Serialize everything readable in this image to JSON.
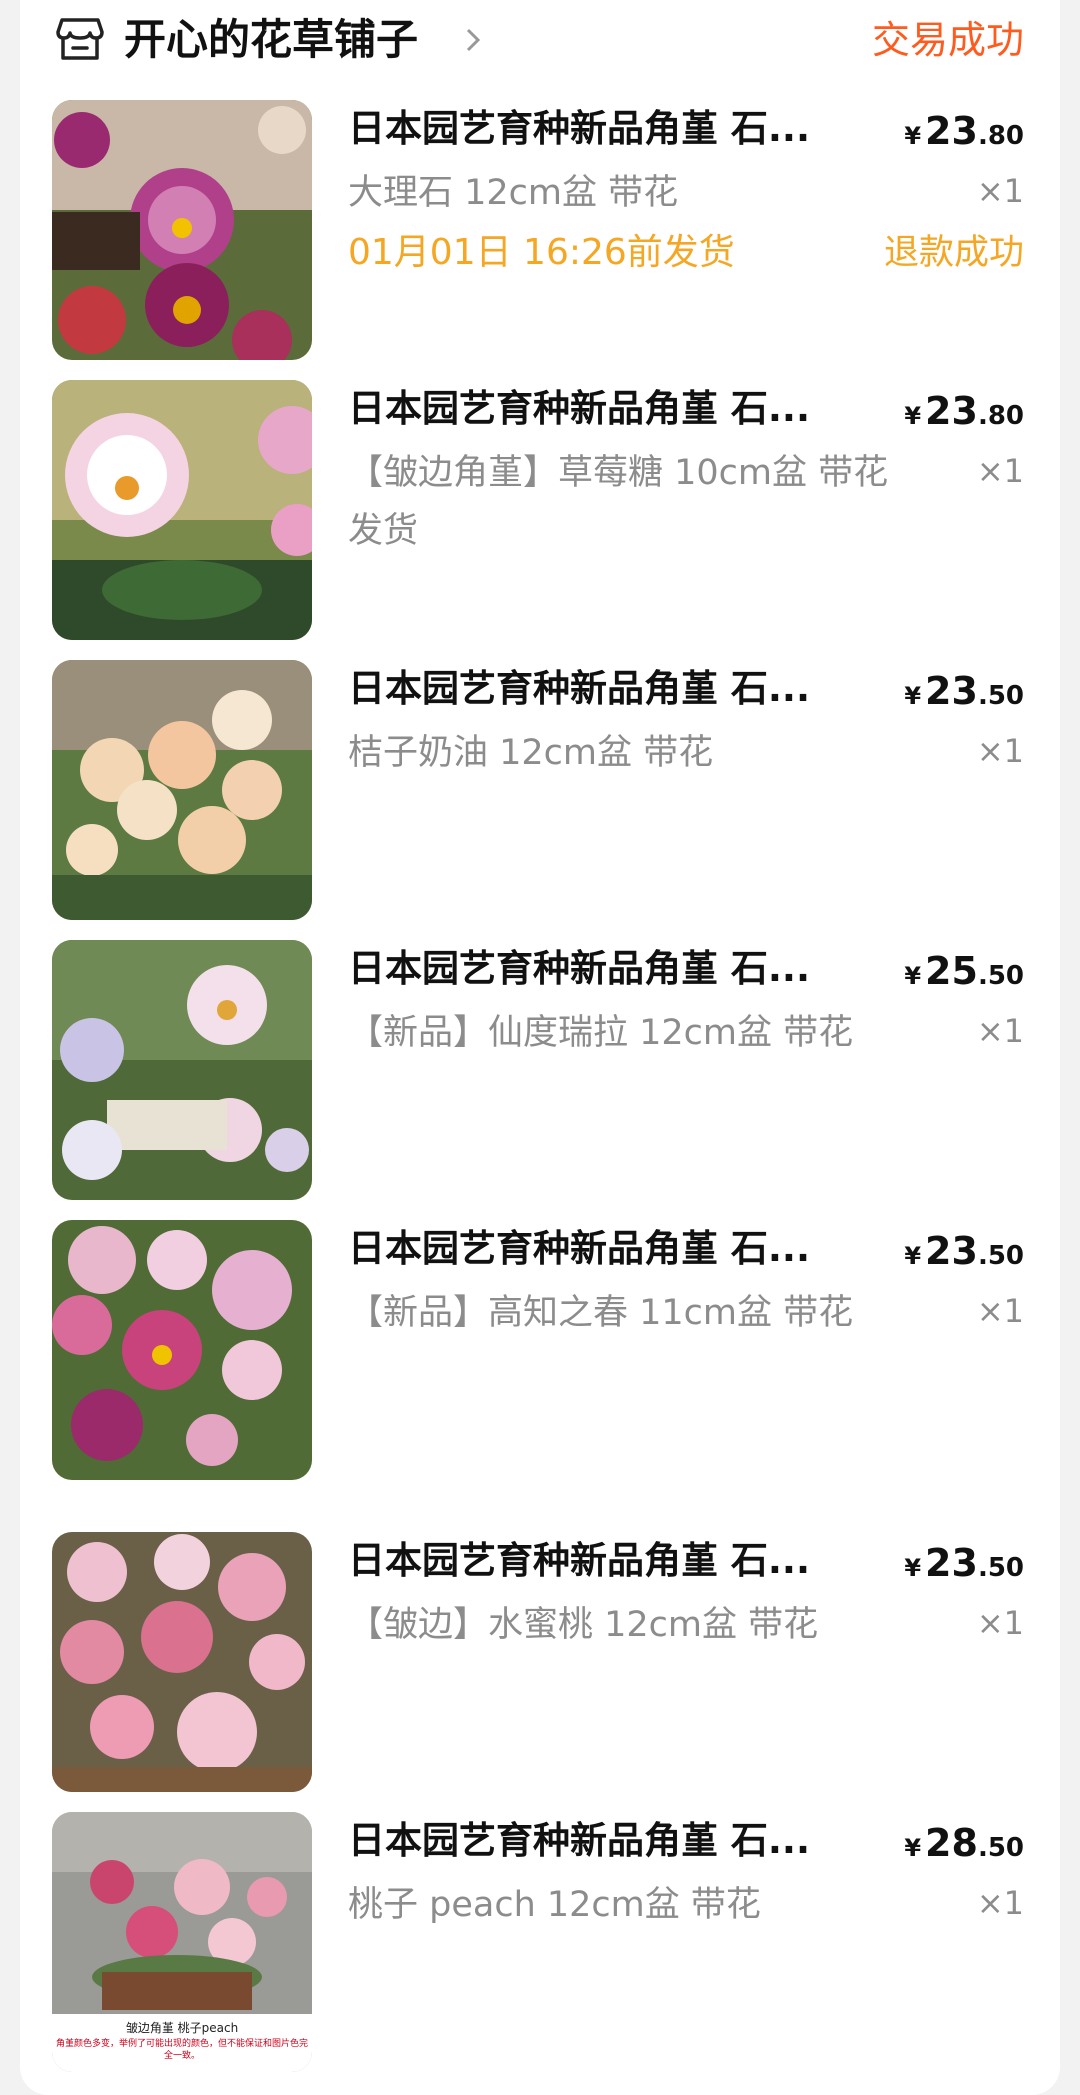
{
  "shop": {
    "name": "开心的花草铺子",
    "order_status": "交易成功"
  },
  "items": [
    {
      "title": "日本园艺育种新品角堇 石...",
      "price_currency": "¥",
      "price_int": "23",
      "price_dec": ".80",
      "sku": "大理石 12cm盆 带花",
      "qty": "×1",
      "ship_note": "01月01日 16:26前发货",
      "refund_status": "退款成功"
    },
    {
      "title": "日本园艺育种新品角堇 石...",
      "price_currency": "¥",
      "price_int": "23",
      "price_dec": ".80",
      "sku": "【皱边角堇】草莓糖 10cm盆 带花发货",
      "qty": "×1"
    },
    {
      "title": "日本园艺育种新品角堇 石...",
      "price_currency": "¥",
      "price_int": "23",
      "price_dec": ".50",
      "sku": "桔子奶油 12cm盆 带花",
      "qty": "×1"
    },
    {
      "title": "日本园艺育种新品角堇 石...",
      "price_currency": "¥",
      "price_int": "25",
      "price_dec": ".50",
      "sku": "【新品】仙度瑞拉 12cm盆 带花",
      "qty": "×1"
    },
    {
      "title": "日本园艺育种新品角堇 石...",
      "price_currency": "¥",
      "price_int": "23",
      "price_dec": ".50",
      "sku": "【新品】高知之春 11cm盆 带花",
      "qty": "×1"
    },
    {
      "title": "日本园艺育种新品角堇 石...",
      "price_currency": "¥",
      "price_int": "23",
      "price_dec": ".50",
      "sku": "【皱边】水蜜桃 12cm盆 带花",
      "qty": "×1"
    },
    {
      "title": "日本园艺育种新品角堇 石...",
      "price_currency": "¥",
      "price_int": "28",
      "price_dec": ".50",
      "sku": "桃子 peach 12cm盆 带花",
      "qty": "×1",
      "image_caption": "皱边角堇 桃子peach",
      "image_note": "角堇颜色多变，举例了可能出现的颜色，但不能保证和图片色完全一致。"
    }
  ],
  "colors": {
    "accent_orange": "#ff5b1f",
    "ship_note_yellow": "#f5a623",
    "muted_text": "#8c8c8c"
  },
  "icons": [
    "store-icon",
    "chevron-right-icon"
  ]
}
